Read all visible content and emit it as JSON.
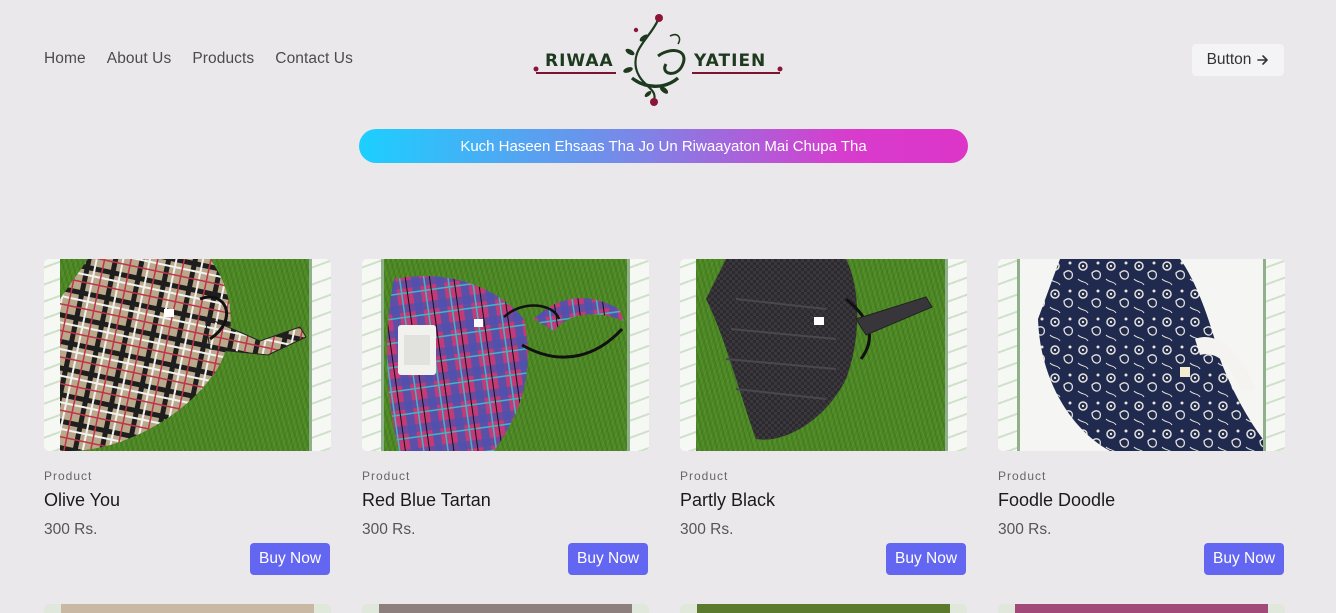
{
  "nav": {
    "items": [
      {
        "label": "Home"
      },
      {
        "label": "About Us"
      },
      {
        "label": "Products"
      },
      {
        "label": "Contact Us"
      }
    ]
  },
  "logo": {
    "left_text": "RIWAA",
    "right_text": "YATIEN"
  },
  "header": {
    "button_label": "Button",
    "button_icon": "arrow-right-icon"
  },
  "tagline": "Kuch Haseen Ehsaas Tha Jo Un Riwaayaton Mai Chupa Tha",
  "colors": {
    "background": "#ebe8ec",
    "accent": "#6366f1",
    "gradient_start": "#1ccfff",
    "gradient_end": "#dc35c8"
  },
  "products": [
    {
      "category": "Product",
      "name": "Olive You",
      "price": "300 Rs.",
      "button": "Buy Now"
    },
    {
      "category": "Product",
      "name": "Red Blue Tartan",
      "price": "300 Rs.",
      "button": "Buy Now"
    },
    {
      "category": "Product",
      "name": "Partly Black",
      "price": "300 Rs.",
      "button": "Buy Now"
    },
    {
      "category": "Product",
      "name": "Foodle Doodle",
      "price": "300 Rs.",
      "button": "Buy Now"
    }
  ]
}
